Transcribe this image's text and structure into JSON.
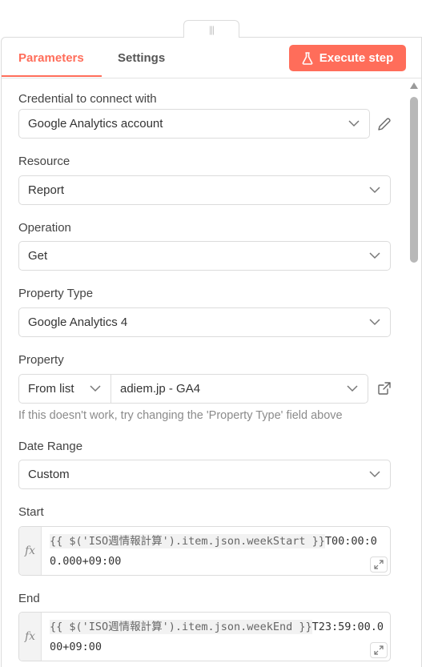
{
  "tabs": [
    {
      "label": "Parameters"
    },
    {
      "label": "Settings"
    }
  ],
  "execute_button": {
    "label": "Execute step",
    "icon": "flask-icon"
  },
  "colors": {
    "accent": "#ff6d5a",
    "border": "#dcdcdc",
    "hint": "#8b8b8b"
  },
  "fields": {
    "credential": {
      "label": "Credential to connect with",
      "value": "Google Analytics account"
    },
    "resource": {
      "label": "Resource",
      "value": "Report"
    },
    "operation": {
      "label": "Operation",
      "value": "Get"
    },
    "property_type": {
      "label": "Property Type",
      "value": "Google Analytics 4"
    },
    "property": {
      "label": "Property",
      "mode": "From list",
      "value": "adiem.jp - GA4",
      "hint": "If this doesn't work, try changing the 'Property Type' field above"
    },
    "date_range": {
      "label": "Date Range",
      "value": "Custom"
    },
    "start": {
      "label": "Start",
      "expr_template": "{{ $('ISO週情報計算').item.json.weekStart }}",
      "expr_suffix": "T00:00:00.000+09:00"
    },
    "end": {
      "label": "End",
      "expr_template": "{{ $('ISO週情報計算').item.json.weekEnd }}",
      "expr_suffix": "T23:59:00.000+09:00"
    }
  }
}
